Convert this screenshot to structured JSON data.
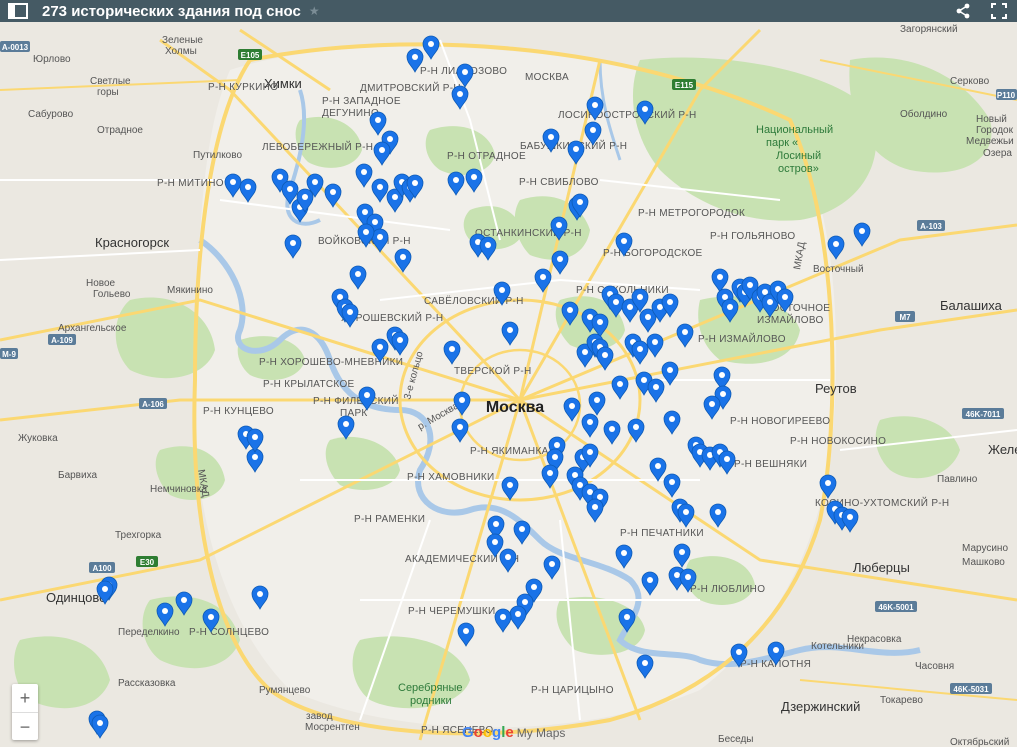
{
  "header": {
    "title": "273 исторических здания под снос",
    "star": "★",
    "colors": {
      "bar": "#455a64",
      "text": "#ffffff"
    }
  },
  "map": {
    "center_label": "Москва",
    "marker_color": "#1a73e8",
    "colors": {
      "land": "#ebe8e1",
      "park": "#c8e2b2",
      "water": "#a9c8e8",
      "road_major": "#fbd872",
      "road_minor": "#ffffff"
    }
  },
  "places": {
    "khimki": "Химки",
    "krasnogorsk": "Красногорск",
    "balashikha": "Балашиха",
    "odintsovo": "Одинцово",
    "lyubertsy": "Люберцы",
    "reutov": "Реутов",
    "yurlovo": "Юрлово",
    "zelenye_kholmy": "Зеленые\nХолмы",
    "saburovo": "Сабурово",
    "svetly": "Светлые\nгоры",
    "otradnoe": "Отрадное",
    "putilkovo": "Путилково",
    "novoe_goltsevo": "Новое\nГольево",
    "myakinino": "Мякинино",
    "arkhangelskoe": "Архангельское",
    "zhukovka": "Жуковка",
    "barvikha": "Барвиха",
    "nemchinovka": "Немчиновка",
    "trekhgorka": "Трехгорка",
    "peredelkino": "Переделкино",
    "rasskazovka": "Рассказовка",
    "rumyantsevo": "Румянцево",
    "zavod": "завод\nМосрентген",
    "serkovo": "Серково",
    "oboldino": "Оболдино",
    "novy_gorodok": "Новый\nГородок",
    "medvezhi": "Медвежьи\nОзера",
    "vostochny": "Восточный",
    "zagoryanskiy": "Загорянский",
    "pavlino": "Павлино",
    "zheleznodorozhny": "Железно",
    "marusino": "Марусино\nМашково",
    "kotelniki": "Котельники",
    "chasovnya": "Часовня",
    "tokarevo": "Токарево",
    "dzerzhinsky": "Дзержинский",
    "oktyabrsky": "Октябрьский",
    "besedy": "Беседы",
    "nekrasovka": "Некрасовка"
  },
  "districts": [
    "Р-Н КУРКИНО",
    "Р-Н ЛИАНОЗОВО",
    "ДМИТРОВСКИЙ Р-Н",
    "Р-Н ЗАПАДНОЕ\nДЕГУНИНО",
    "МОСКВА",
    "ЛОСИНООСТРОВСКИЙ Р-Н",
    "ЛЕВОБЕРЕЖНЫЙ Р-Н",
    "Р-Н ОТРАДНОЕ",
    "БАБУШКИНСКИЙ Р-Н",
    "Р-Н МИТИНО",
    "Р-Н СВИБЛОВО",
    "Р-Н МЕТРОГОРОДОК",
    "ВОЙКОВСКИЙ Р-Н",
    "ОСТАНКИНСКИЙ Р-Н",
    "Р-Н ГОЛЬЯНОВО",
    "Р-Н БОГОРОДСКОЕ",
    "Р-Н СОКОЛЬНИКИ",
    "САВЁЛОВСКИЙ Р-Н",
    "ХОРОШЕВСКИЙ Р-Н",
    "Р-Н ХОРОШЕВО-МНЕВНИКИ",
    "ТВЕРСКОЙ Р-Н",
    "Р-Н ИЗМАЙЛОВО",
    "Р-Н КРЫЛАТСКОЕ",
    "Р-Н ФИЛЕВСКИЙ\nПАРК",
    "Р-Н КУНЦЕВО",
    "Р-Н НОВОГИРЕЕВО",
    "Р-Н ЯКИМАНКА",
    "Р-Н ХАМОВНИКИ",
    "Р-Н НОВОКОСИНО",
    "Р-Н ВЕШНЯКИ",
    "Р-Н РАМЕНКИ",
    "КОСИНО-УХТОМСКИЙ Р-Н",
    "Р-Н ПЕЧАТНИКИ",
    "АКАДЕМИЧЕСКИЙ Р-Н",
    "Р-Н ЛЮБЛИНО",
    "Р-Н ЧЕРЕМУШКИ",
    "Р-Н СОЛНЦЕВО",
    "Р-Н ЦАРИЦЫНО",
    "Р-Н ЯСЕНЕВО",
    "Р-Н КАПОТНЯ",
    "ВОСТОЧНОЕ\nИЗМАЙЛОВО"
  ],
  "parks": {
    "losiny": "Национальный\nпарк «\nЛосиный\nостров»",
    "serebryanye": "Серебряные\nродники"
  },
  "roads": [
    "A-103",
    "M7",
    "E30",
    "A100",
    "E115",
    "E105",
    "M-9",
    "A-106",
    "A-109",
    "46K-5001",
    "46K-5031",
    "46K-7011",
    "A-0013",
    "P110"
  ],
  "ring_labels": [
    "3-е кольцо",
    "МКАД",
    "р. Москва"
  ],
  "zoom": {
    "in": "+",
    "out": "−"
  },
  "attribution": {
    "google": "Google",
    "mymaps": "My Maps"
  }
}
